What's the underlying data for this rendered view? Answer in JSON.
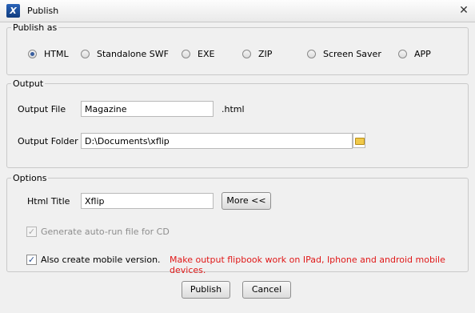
{
  "window": {
    "title": "Publish",
    "close_glyph": "✕",
    "app_icon_letter": "X"
  },
  "publish_as": {
    "label": "Publish as",
    "options": [
      {
        "label": "HTML",
        "selected": true
      },
      {
        "label": "Standalone SWF",
        "selected": false
      },
      {
        "label": "EXE",
        "selected": false
      },
      {
        "label": "ZIP",
        "selected": false
      },
      {
        "label": "Screen Saver",
        "selected": false
      },
      {
        "label": "APP",
        "selected": false
      }
    ]
  },
  "output": {
    "label": "Output",
    "file_label": "Output File",
    "file_value": "Magazine",
    "file_ext": ".html",
    "folder_label": "Output Folder",
    "folder_value": "D:\\Documents\\xflip",
    "folder_icon": "folder-icon"
  },
  "options": {
    "label": "Options",
    "html_title_label": "Html Title",
    "html_title_value": "Xflip",
    "more_label": "More <<",
    "autorun_label": "Generate auto-run file for CD",
    "autorun_checked": true,
    "autorun_enabled": false,
    "mobile_label": "Also create mobile version.",
    "mobile_checked": true,
    "mobile_note": "Make output flipbook work on IPad, Iphone and android mobile devices.",
    "mobile_note_color": "#e01818"
  },
  "buttons": {
    "publish": "Publish",
    "cancel": "Cancel"
  }
}
